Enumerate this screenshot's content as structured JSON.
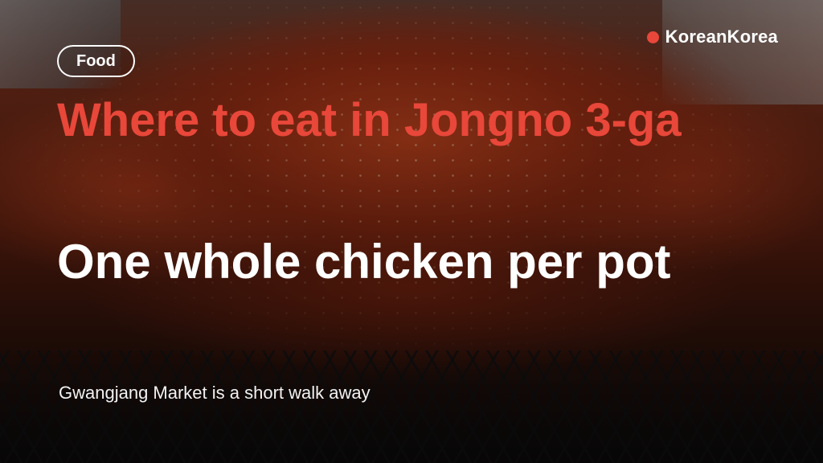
{
  "brand": {
    "name": "KoreanKorea",
    "dot_color": "#e8473a"
  },
  "category": {
    "label": "Food"
  },
  "headline": "Where to eat in Jongno 3-ga",
  "subheadline": "One whole chicken per pot",
  "caption": "Gwangjang Market is a short walk away",
  "colors": {
    "accent": "#e8473a",
    "text": "#ffffff"
  }
}
